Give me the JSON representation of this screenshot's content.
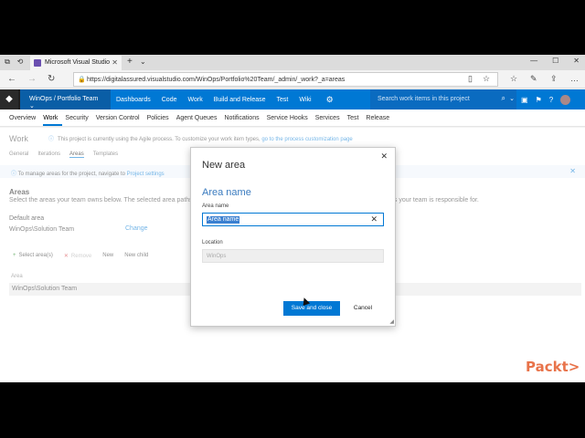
{
  "browser": {
    "tab_title": "Microsoft Visual Studio",
    "url": "https://digitalassured.visualstudio.com/WinOps/Portfolio%20Team/_admin/_work?_a=areas"
  },
  "vsts": {
    "project": "WinOps / Portfolio Team",
    "hubs": [
      "Dashboards",
      "Code",
      "Work",
      "Build and Release",
      "Test",
      "Wiki"
    ],
    "search_placeholder": "Search work items in this project"
  },
  "admin_nav": {
    "items": [
      "Overview",
      "Work",
      "Security",
      "Version Control",
      "Policies",
      "Agent Queues",
      "Notifications",
      "Service Hooks",
      "Services",
      "Test",
      "Release"
    ],
    "selected": "Work"
  },
  "page": {
    "title": "Work",
    "info": "This project is currently using the Agile process. To customize your work item types,",
    "info_link": "go to the process customization page",
    "subnav": [
      "General",
      "Iterations",
      "Areas",
      "Templates"
    ],
    "manage_text": "To manage areas for the project, navigate to",
    "manage_link": "Project settings",
    "areas_heading": "Areas",
    "areas_desc": "Select the areas your team owns below. The selected area paths",
    "areas_desc2": "es your team is responsible for.",
    "default_area_label": "Default area",
    "default_area_value": "WinOps\\Solution Team",
    "change_label": "Change",
    "toolbar": {
      "select": "Select area(s)",
      "remove": "Remove",
      "new": "New",
      "new_child": "New child"
    },
    "column_header": "Area",
    "rows": [
      "WinOps\\Solution Team"
    ]
  },
  "dialog": {
    "title": "New area",
    "section": "Area name",
    "name_label": "Area name",
    "name_value": "Area name",
    "location_label": "Location",
    "location_value": "WinOps",
    "save": "Save and close",
    "cancel": "Cancel"
  },
  "watermark": "Packt>"
}
